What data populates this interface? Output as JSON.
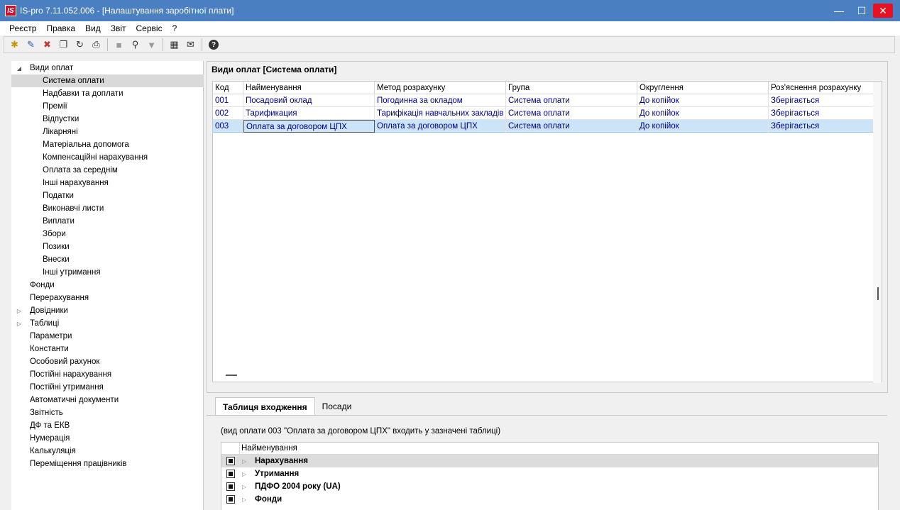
{
  "window": {
    "logo": "IS",
    "title": "IS-pro 7.11.052.006 - [Налаштування заробітної плати]",
    "controls": {
      "minimize": "—",
      "maximize": "☐",
      "close": "✕"
    }
  },
  "menu": [
    "Реєстр",
    "Правка",
    "Вид",
    "Звіт",
    "Сервіс",
    "?"
  ],
  "toolbar": {
    "icons": [
      "new-icon",
      "edit-icon",
      "delete-icon",
      "copy-icon",
      "refresh-icon",
      "print-icon",
      "stop-icon",
      "search-icon",
      "filter-icon",
      "calculator-icon",
      "mail-icon",
      "help-icon"
    ],
    "glyphs": {
      "new": "✱",
      "edit": "✎",
      "delete": "✖",
      "copy": "❐",
      "refresh": "↻",
      "print": "⎙",
      "stop": "■",
      "search": "⚲",
      "filter": "▼",
      "calculator": "▦",
      "mail": "✉",
      "help": "?"
    }
  },
  "tree": {
    "expanded_arrow": "◢",
    "collapsed_arrow": "▷",
    "root": "Види оплат",
    "children": [
      "Система оплати",
      "Надбавки та доплати",
      "Премії",
      "Відпустки",
      "Лікарняні",
      "Матеріальна допомога",
      "Компенсаційні нарахування",
      "Оплата за середнім",
      "Інші нарахування",
      "Податки",
      "Виконавчі листи",
      "Виплати",
      "Збори",
      "Позики",
      "Внески",
      "Інші утримання"
    ],
    "top_level": [
      "Фонди",
      "Перерахування",
      "Довідники",
      "Таблиці",
      "Параметри",
      "Константи",
      "Особовий рахунок",
      "Постійні нарахування",
      "Постійні утримання",
      "Автоматичні документи",
      "Звітність",
      "ДФ та ЕКВ",
      "Нумерація",
      "Калькуляція",
      "Переміщення працівників"
    ],
    "selected": "Система оплати"
  },
  "main": {
    "title": "Види оплат [Система оплати]",
    "columns": [
      "Код",
      "Найменування",
      "Метод розрахунку",
      "Група",
      "Округлення",
      "Роз'яснення розрахунку"
    ],
    "rows": [
      [
        "001",
        "Посадовий оклад",
        "Погодинна за окладом",
        "Система оплати",
        "До копійок",
        "Зберігається"
      ],
      [
        "002",
        "Тарификация",
        "Тарифікація навчальних закладів",
        "Система оплати",
        "До копійок",
        "Зберігається"
      ],
      [
        "003",
        "Оплата за договором ЦПХ",
        "Оплата за договором ЦПХ",
        "Система оплати",
        "До копійок",
        "Зберігається"
      ]
    ],
    "selected_row": 2
  },
  "bottom": {
    "tabs": [
      "Таблиця входження",
      "Посади"
    ],
    "active_tab": "Таблиця входження",
    "info": "(вид оплати 003 \"Оплата за договором ЦПХ\" входить у зазначені таблиці)",
    "column": "Найменування",
    "arrow": "▷",
    "items": [
      "Нарахування",
      "Утримання",
      "ПДФО 2004 року (UA)",
      "Фонди"
    ]
  }
}
